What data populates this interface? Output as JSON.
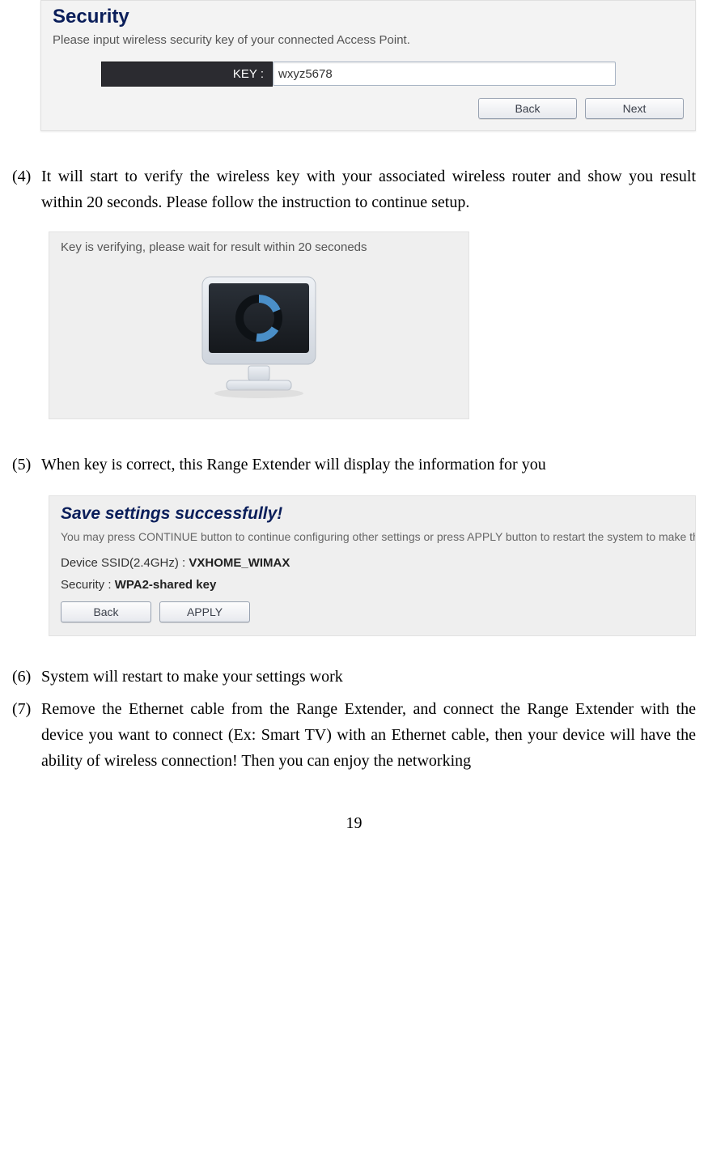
{
  "security_panel": {
    "title": "Security",
    "subtitle": "Please input wireless security key of your connected Access Point.",
    "key_label": "KEY :",
    "key_value": "wxyz5678",
    "back_btn": "Back",
    "next_btn": "Next"
  },
  "step4": {
    "num": "(4)",
    "text": "It will start to verify the wireless key with your associated wireless router and show you result within 20 seconds. Please follow the instruction to continue setup."
  },
  "verify_panel": {
    "title": "Key is verifying, please wait for result within 20 seconeds"
  },
  "step5": {
    "num": "(5)",
    "text": "When key is correct, this Range Extender will display the information for you"
  },
  "save_panel": {
    "title": "Save settings successfully!",
    "subtitle": "You may press CONTINUE button to continue configuring other settings or press APPLY button to restart the system to make the changes take effect.",
    "ssid_label": "Device SSID(2.4GHz) : ",
    "ssid_value": "VXHOME_WIMAX",
    "security_label": "Security : ",
    "security_value": "WPA2-shared key",
    "back_btn": "Back",
    "apply_btn": "APPLY"
  },
  "step6": {
    "num": "(6)",
    "text": "System will restart to make your settings work"
  },
  "step7": {
    "num": "(7)",
    "text": "Remove the Ethernet cable from the Range Extender, and connect the Range Extender with the device you want to connect (Ex: Smart TV) with an Ethernet cable, then your device will have the ability of wireless connection! Then you can enjoy the networking"
  },
  "page_number": "19"
}
